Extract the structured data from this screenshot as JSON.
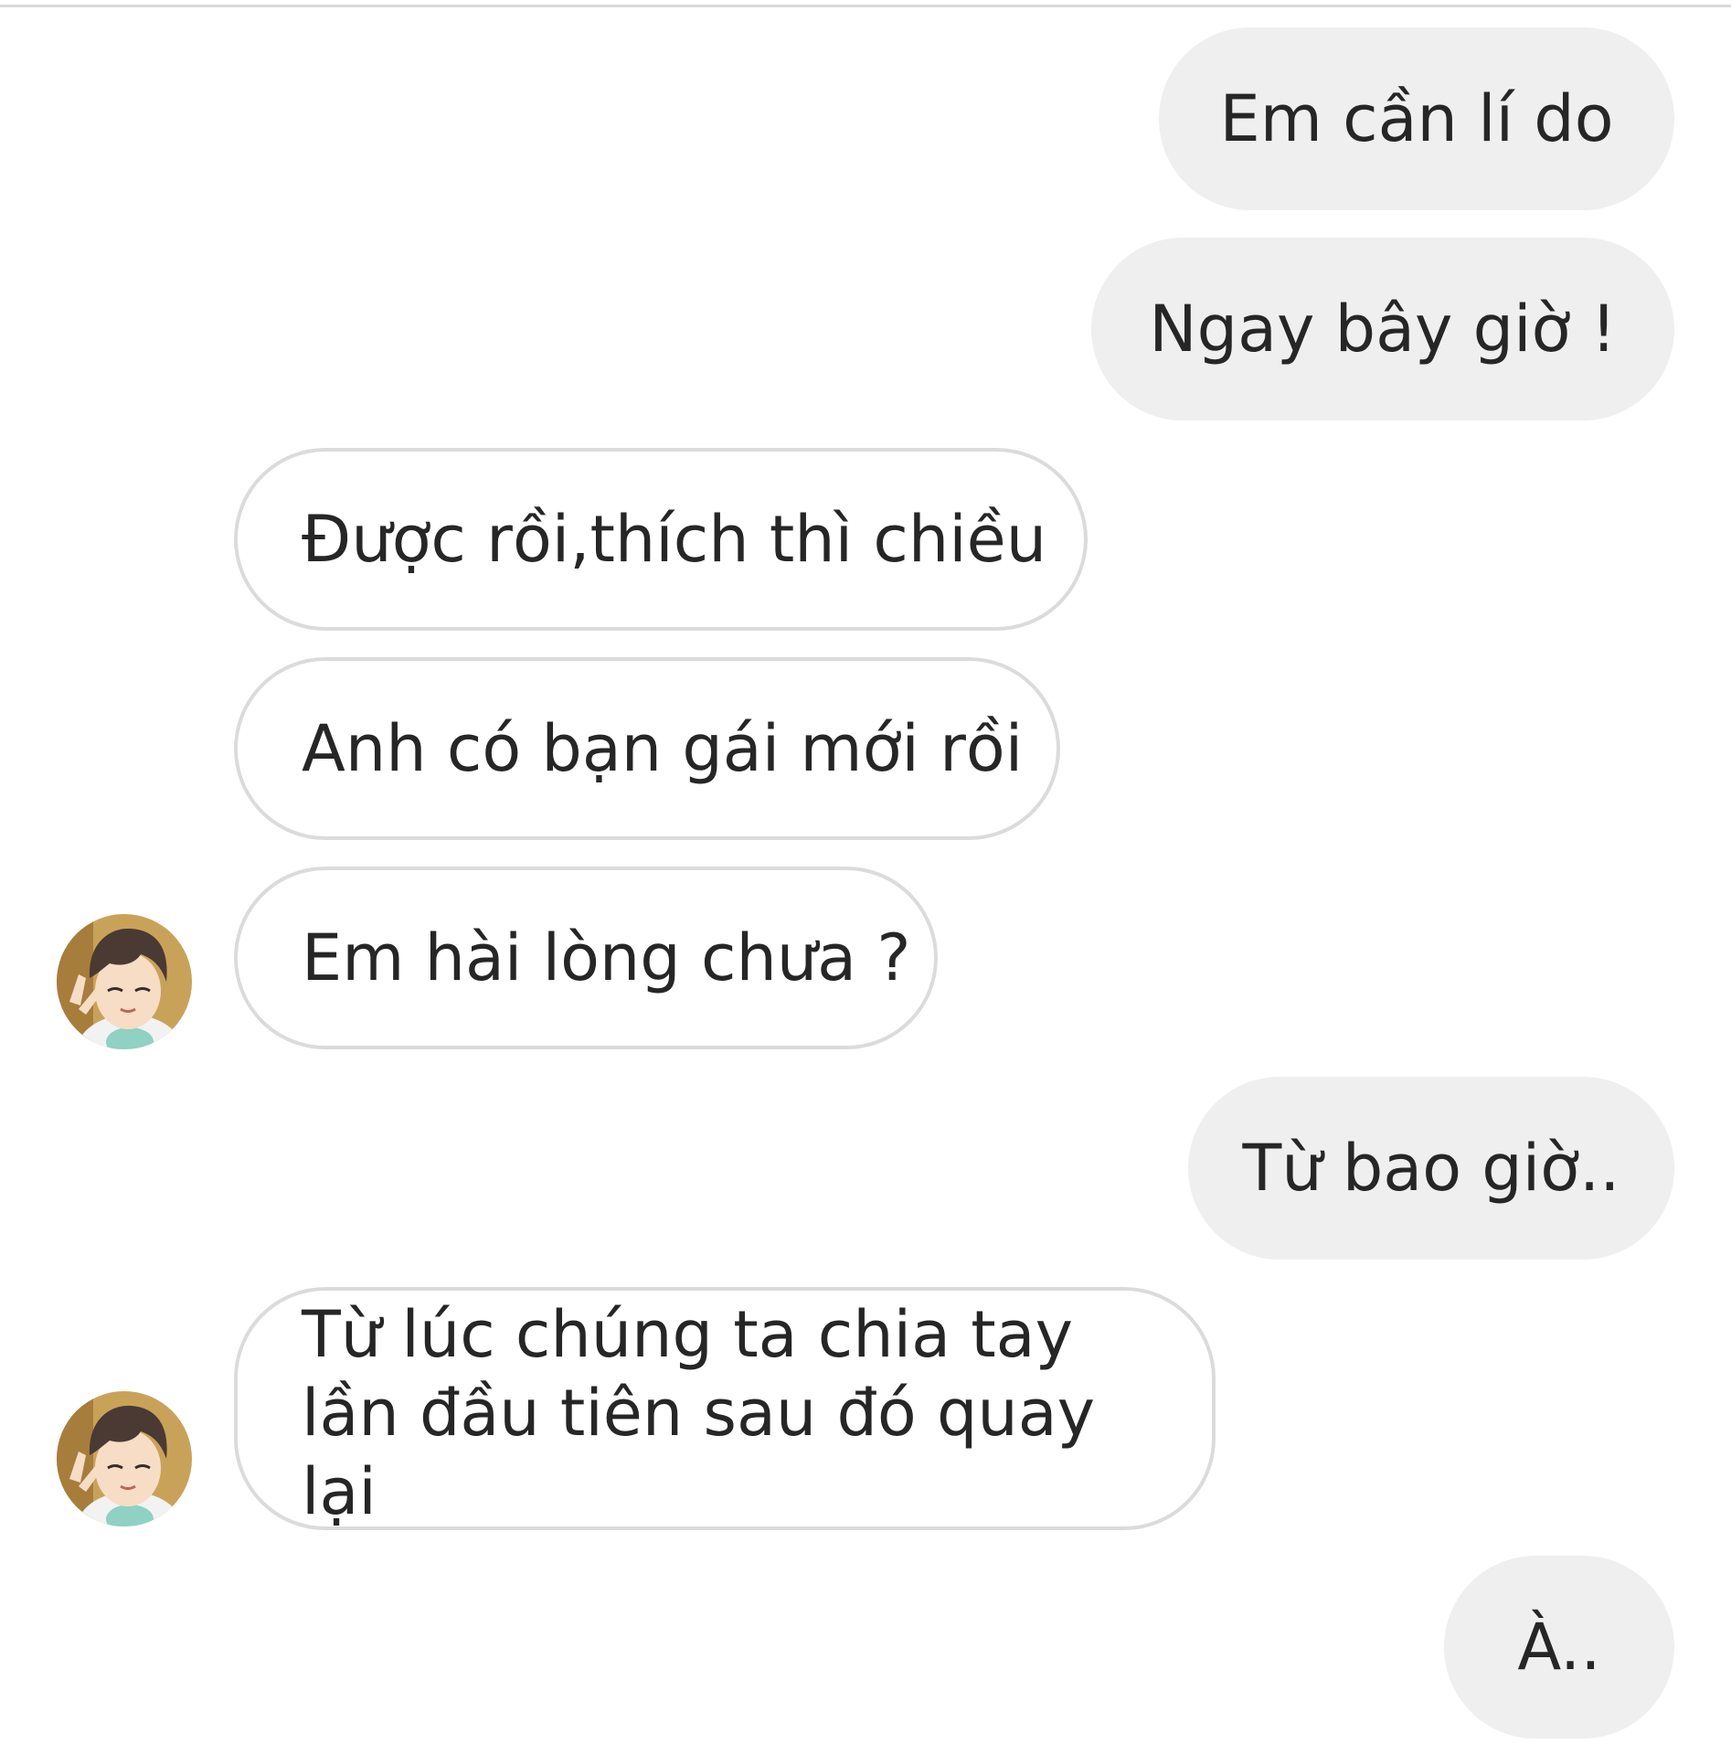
{
  "messages": [
    {
      "from": "me",
      "text": "Em cần lí do"
    },
    {
      "from": "me",
      "text": "Ngay bây giờ !"
    },
    {
      "from": "them",
      "text": "Được rồi,thích thì chiều"
    },
    {
      "from": "them",
      "text": "Anh có bạn gái mới rồi"
    },
    {
      "from": "them",
      "text": "Em hài lòng chưa ?",
      "avatar": "anime-boy-avatar"
    },
    {
      "from": "me",
      "text": "Từ bao giờ.."
    },
    {
      "from": "them",
      "text": "Từ lúc chúng ta chia tay lần đầu tiên sau đó quay lại",
      "avatar": "anime-boy-avatar"
    },
    {
      "from": "me",
      "text": "À.."
    }
  ],
  "colors": {
    "sent_bubble": "#efefef",
    "received_border": "#dbdbdb",
    "text": "#262626"
  }
}
